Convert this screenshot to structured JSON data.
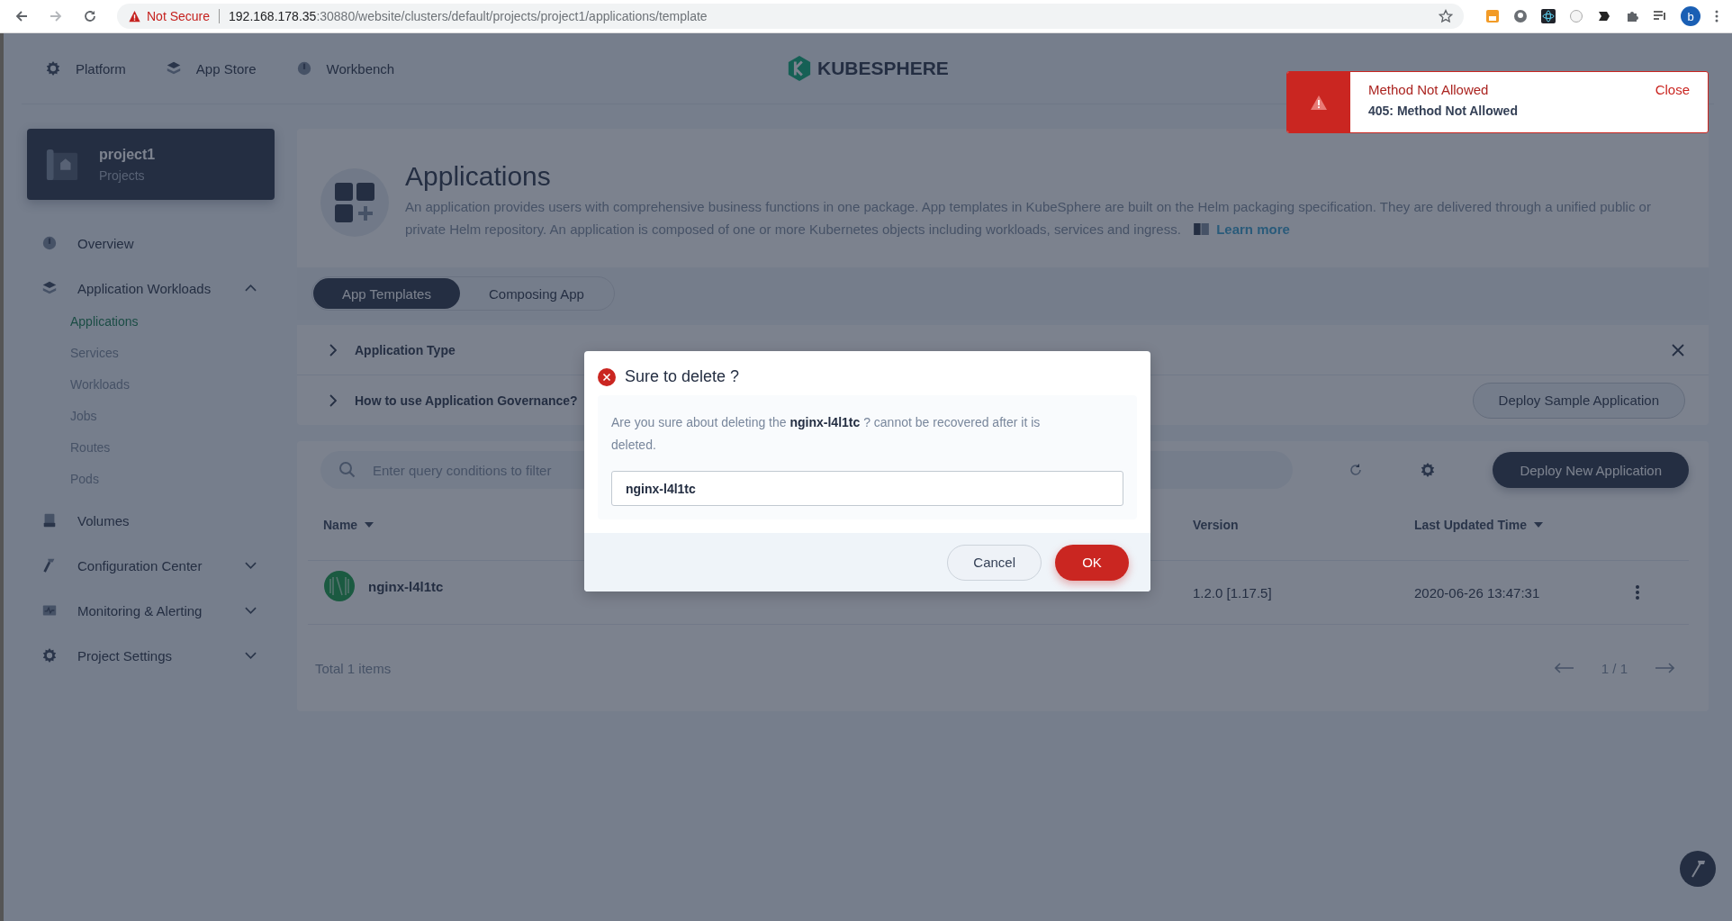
{
  "browser": {
    "security": "Not Secure",
    "url_host": "192.168.178.35",
    "url_path": ":30880/website/clusters/default/projects/project1/applications/template",
    "profile_initial": "b"
  },
  "top_nav": [
    {
      "label": "Platform"
    },
    {
      "label": "App Store"
    },
    {
      "label": "Workbench"
    }
  ],
  "logo": {
    "text": "KUBESPHERE"
  },
  "project": {
    "name": "project1",
    "type": "Projects"
  },
  "sidebar": [
    {
      "kind": "link",
      "label": "Overview"
    },
    {
      "kind": "group",
      "label": "Application Workloads",
      "expanded": true,
      "children": [
        {
          "label": "Applications",
          "selected": true
        },
        {
          "label": "Services",
          "selected": false
        },
        {
          "label": "Workloads",
          "selected": false
        },
        {
          "label": "Jobs",
          "selected": false
        },
        {
          "label": "Routes",
          "selected": false
        },
        {
          "label": "Pods",
          "selected": false
        }
      ]
    },
    {
      "kind": "link",
      "label": "Volumes"
    },
    {
      "kind": "group",
      "label": "Configuration Center",
      "expanded": false
    },
    {
      "kind": "group",
      "label": "Monitoring & Alerting",
      "expanded": false
    },
    {
      "kind": "group",
      "label": "Project Settings",
      "expanded": false
    }
  ],
  "header": {
    "title": "Applications",
    "description": "An application provides users with comprehensive business functions in one package. App templates in KubeSphere are built on the Helm packaging specification. They are delivered through a unified public or private Helm repository. An application is composed of one or more Kubernetes objects including workloads, services and ingress.",
    "link": "Learn more"
  },
  "tabs": [
    {
      "label": "App Templates",
      "selected": true
    },
    {
      "label": "Composing App",
      "selected": false
    }
  ],
  "sections": [
    {
      "label": "Application Type",
      "expanded": false
    },
    {
      "label": "How to use Application Governance?",
      "expanded": false
    }
  ],
  "deploy_sample": "Deploy Sample Application",
  "toolbar": {
    "placeholder": "Enter query conditions to filter",
    "deploy_button": "Deploy New Application"
  },
  "table": {
    "columns": [
      {
        "label": "Name",
        "sortable": true
      },
      {
        "label": "Version",
        "sortable": false
      },
      {
        "label": "Last Updated Time",
        "sortable": true
      }
    ],
    "rows": [
      {
        "name": "nginx-l4l1tc",
        "version": "1.2.0 [1.17.5]",
        "updated": "2020-06-26 13:47:31"
      }
    ]
  },
  "footer": {
    "total": "Total 1 items",
    "page": "1 / 1"
  },
  "dialog": {
    "title": "Sure to delete ?",
    "message": "Are you sure about deleting the **nginx-l4l1tc** ? cannot be recovered after it is deleted.",
    "value": "nginx-l4l1tc",
    "cancel": "Cancel",
    "ok": "OK"
  },
  "toast": {
    "title": "Method Not Allowed",
    "message": "405: Method Not Allowed",
    "close": "Close"
  }
}
